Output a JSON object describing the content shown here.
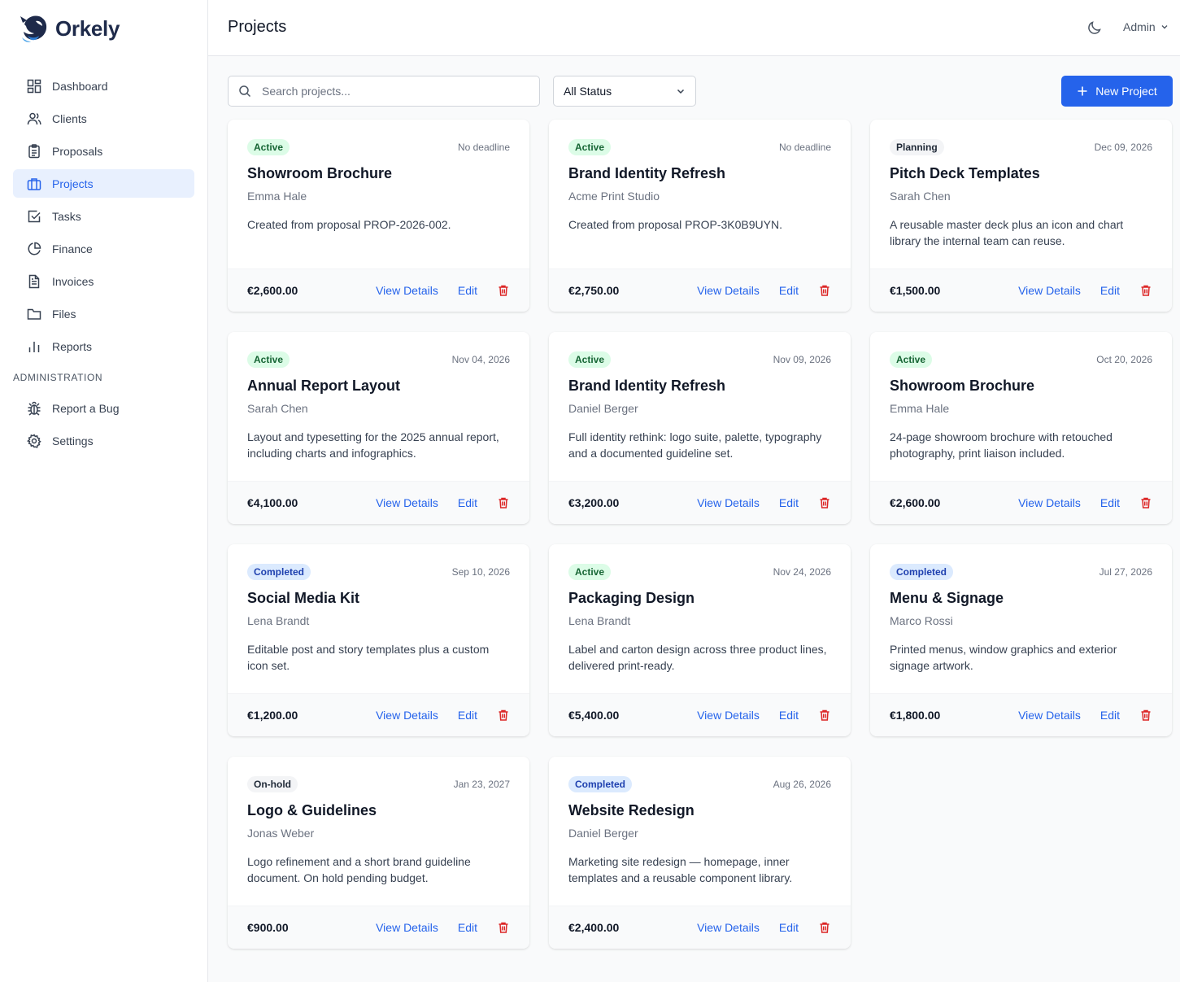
{
  "app": {
    "name": "Orkely"
  },
  "sidebar": {
    "items": [
      {
        "label": "Dashboard",
        "icon": "dashboard-icon"
      },
      {
        "label": "Clients",
        "icon": "users-icon"
      },
      {
        "label": "Proposals",
        "icon": "clipboard-icon"
      },
      {
        "label": "Projects",
        "icon": "briefcase-icon",
        "active": true
      },
      {
        "label": "Tasks",
        "icon": "check-square-icon"
      },
      {
        "label": "Finance",
        "icon": "pie-chart-icon"
      },
      {
        "label": "Invoices",
        "icon": "file-text-icon"
      },
      {
        "label": "Files",
        "icon": "folder-icon"
      },
      {
        "label": "Reports",
        "icon": "bar-chart-icon"
      }
    ],
    "section_label": "ADMINISTRATION",
    "admin_items": [
      {
        "label": "Report a Bug",
        "icon": "bug-icon"
      },
      {
        "label": "Settings",
        "icon": "gear-icon"
      }
    ]
  },
  "header": {
    "title": "Projects",
    "user": "Admin"
  },
  "toolbar": {
    "search_placeholder": "Search projects...",
    "status_filter": "All Status",
    "new_button": "New Project"
  },
  "card_actions": {
    "view": "View Details",
    "edit": "Edit"
  },
  "colors": {
    "accent": "#2563eb",
    "delete": "#dc2626"
  },
  "projects": [
    {
      "status": "Active",
      "deadline": "No deadline",
      "title": "Showroom Brochure",
      "client": "Emma Hale",
      "description": "Created from proposal PROP-2026-002.",
      "amount": "€2,600.00"
    },
    {
      "status": "Active",
      "deadline": "No deadline",
      "title": "Brand Identity Refresh",
      "client": "Acme Print Studio",
      "description": "Created from proposal PROP-3K0B9UYN.",
      "amount": "€2,750.00"
    },
    {
      "status": "Planning",
      "deadline": "Dec 09, 2026",
      "title": "Pitch Deck Templates",
      "client": "Sarah Chen",
      "description": "A reusable master deck plus an icon and chart library the internal team can reuse.",
      "amount": "€1,500.00"
    },
    {
      "status": "Active",
      "deadline": "Nov 04, 2026",
      "title": "Annual Report Layout",
      "client": "Sarah Chen",
      "description": "Layout and typesetting for the 2025 annual report, including charts and infographics.",
      "amount": "€4,100.00"
    },
    {
      "status": "Active",
      "deadline": "Nov 09, 2026",
      "title": "Brand Identity Refresh",
      "client": "Daniel Berger",
      "description": "Full identity rethink: logo suite, palette, typography and a documented guideline set.",
      "amount": "€3,200.00"
    },
    {
      "status": "Active",
      "deadline": "Oct 20, 2026",
      "title": "Showroom Brochure",
      "client": "Emma Hale",
      "description": "24-page showroom brochure with retouched photography, print liaison included.",
      "amount": "€2,600.00"
    },
    {
      "status": "Completed",
      "deadline": "Sep 10, 2026",
      "title": "Social Media Kit",
      "client": "Lena Brandt",
      "description": "Editable post and story templates plus a custom icon set.",
      "amount": "€1,200.00"
    },
    {
      "status": "Active",
      "deadline": "Nov 24, 2026",
      "title": "Packaging Design",
      "client": "Lena Brandt",
      "description": "Label and carton design across three product lines, delivered print-ready.",
      "amount": "€5,400.00"
    },
    {
      "status": "Completed",
      "deadline": "Jul 27, 2026",
      "title": "Menu & Signage",
      "client": "Marco Rossi",
      "description": "Printed menus, window graphics and exterior signage artwork.",
      "amount": "€1,800.00"
    },
    {
      "status": "On-hold",
      "deadline": "Jan 23, 2027",
      "title": "Logo & Guidelines",
      "client": "Jonas Weber",
      "description": "Logo refinement and a short brand guideline document. On hold pending budget.",
      "amount": "€900.00"
    },
    {
      "status": "Completed",
      "deadline": "Aug 26, 2026",
      "title": "Website Redesign",
      "client": "Daniel Berger",
      "description": "Marketing site redesign — homepage, inner templates and a reusable component library.",
      "amount": "€2,400.00"
    }
  ]
}
